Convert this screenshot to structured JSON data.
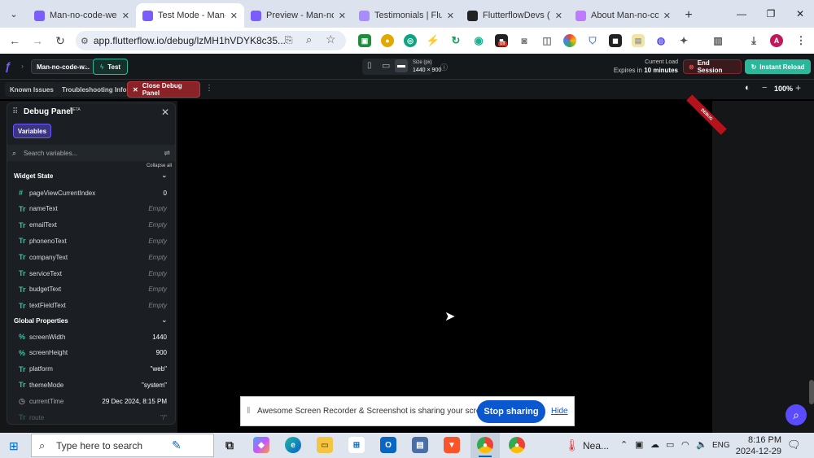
{
  "browser": {
    "tabs": [
      {
        "title": "Man-no-code-web",
        "color": "#7b5cff",
        "active": false
      },
      {
        "title": "Test Mode - Man-n",
        "color": "#7b5cff",
        "active": true
      },
      {
        "title": "Preview - Man-no",
        "color": "#7b5cff",
        "active": false
      },
      {
        "title": "Testimonials | Flutt",
        "color": "#a98cff",
        "active": false
      },
      {
        "title": "FlutterflowDevs (Th",
        "color": "#222222",
        "active": false
      },
      {
        "title": "About Man-no-co",
        "color": "#c07aff",
        "active": false
      }
    ],
    "url": "app.flutterflow.io/debug/lzMH1hVDYK8c35...",
    "profile_letter": "A",
    "badge": "off"
  },
  "ff": {
    "project_name": "Man-no-code-w...",
    "mode_label": "Test",
    "size_label": "Size (px)",
    "size_value": "1440 × 900",
    "current_load": "Current Load",
    "expires_prefix": "Expires in",
    "expires_value": "10 minutes",
    "end_session": "End Session",
    "instant_reload": "Instant Reload",
    "known_issues": "Known Issues",
    "troubleshooting": "Troubleshooting Info",
    "close_debug": "Close Debug Panel",
    "zoom": "100%"
  },
  "debug_panel": {
    "title": "Debug Panel",
    "beta": "BETA",
    "tab_variables": "Variables",
    "search_placeholder": "Search variables...",
    "collapse_all": "Collapse all",
    "widget_state_title": "Widget State",
    "widget_state": [
      {
        "icon": "#",
        "name": "pageViewCurrentIndex",
        "value": "0",
        "empty": false
      },
      {
        "icon": "Tr",
        "name": "nameText",
        "value": "Empty",
        "empty": true
      },
      {
        "icon": "Tr",
        "name": "emailText",
        "value": "Empty",
        "empty": true
      },
      {
        "icon": "Tr",
        "name": "phonenoText",
        "value": "Empty",
        "empty": true
      },
      {
        "icon": "Tr",
        "name": "companyText",
        "value": "Empty",
        "empty": true
      },
      {
        "icon": "Tr",
        "name": "serviceText",
        "value": "Empty",
        "empty": true
      },
      {
        "icon": "Tr",
        "name": "budgetText",
        "value": "Empty",
        "empty": true
      },
      {
        "icon": "Tr",
        "name": "textFieldText",
        "value": "Empty",
        "empty": true
      }
    ],
    "global_title": "Global Properties",
    "global": [
      {
        "icon": "%",
        "name": "screenWidth",
        "value": "1440"
      },
      {
        "icon": "%",
        "name": "screenHeight",
        "value": "900"
      },
      {
        "icon": "Tr",
        "name": "platform",
        "value": "\"web\""
      },
      {
        "icon": "Tr",
        "name": "themeMode",
        "value": "\"system\""
      },
      {
        "icon": "◷",
        "name": "currentTime",
        "value": "29 Dec 2024, 8:15 PM"
      },
      {
        "icon": "Tr",
        "name": "route",
        "value": "\"/\""
      }
    ]
  },
  "share_bar": {
    "message": "Awesome Screen Recorder & Screenshot is sharing your screen.",
    "stop": "Stop sharing",
    "hide": "Hide"
  },
  "taskbar": {
    "search_placeholder": "Type here to search",
    "weather": "Nea...",
    "lang": "ENG",
    "time": "8:16 PM",
    "date": "2024-12-29"
  },
  "preview_ribbon": "DEBUG"
}
